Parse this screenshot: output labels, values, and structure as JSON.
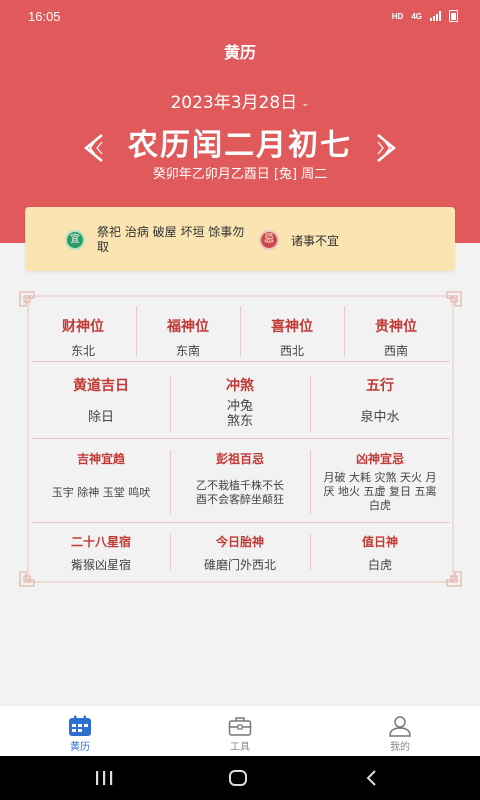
{
  "status": {
    "time": "16:05",
    "hd": "HD",
    "net": "4G"
  },
  "app": {
    "title": "黄历"
  },
  "date": {
    "selected": "2023年3月28日",
    "chev": "⌄"
  },
  "lunar": {
    "title": "农历闰二月初七",
    "ganzhi": "癸卯年乙卯月乙酉日 [兔] 周二"
  },
  "yiji": {
    "yi_badge": "宜",
    "yi_text": "祭祀 治病 破屋 坏垣 馀事勿取",
    "ji_badge": "忌",
    "ji_text": "诸事不宜"
  },
  "row1": [
    {
      "head": "财神位",
      "value": "东北"
    },
    {
      "head": "福神位",
      "value": "东南"
    },
    {
      "head": "喜神位",
      "value": "西北"
    },
    {
      "head": "贵神位",
      "value": "西南"
    }
  ],
  "row2": [
    {
      "head": "黄道吉日",
      "value": "除日"
    },
    {
      "head": "冲煞",
      "value_1": "冲兔",
      "value_2": "煞东"
    },
    {
      "head": "五行",
      "value": "泉中水"
    }
  ],
  "row3": [
    {
      "head": "吉神宜趋",
      "value": "玉宇 除神 玉堂 鸣吠"
    },
    {
      "head": "彭祖百忌",
      "value_1": "乙不栽植千株不长",
      "value_2": "酉不会客醉坐颠狂"
    },
    {
      "head": "凶神宜忌",
      "value_1": "月破 大耗 灾煞 天火 月",
      "value_2": "厌 地火 五虚 复日 五离",
      "value_3": "白虎"
    }
  ],
  "row4": [
    {
      "head": "二十八星宿",
      "value": "觜猴凶星宿"
    },
    {
      "head": "今日胎神",
      "value": "碓磨门外西北"
    },
    {
      "head": "值日神",
      "value": "白虎"
    }
  ],
  "tabs": [
    {
      "label": "黄历",
      "icon": "calendar-icon",
      "active": true
    },
    {
      "label": "工具",
      "icon": "toolbox-icon",
      "active": false
    },
    {
      "label": "我的",
      "icon": "user-icon",
      "active": false
    }
  ],
  "colors": {
    "header_red": "#e05a5b",
    "heading_red": "#c23a36",
    "card_yellow": "#fae4b2",
    "active_blue": "#2c6fd1"
  }
}
